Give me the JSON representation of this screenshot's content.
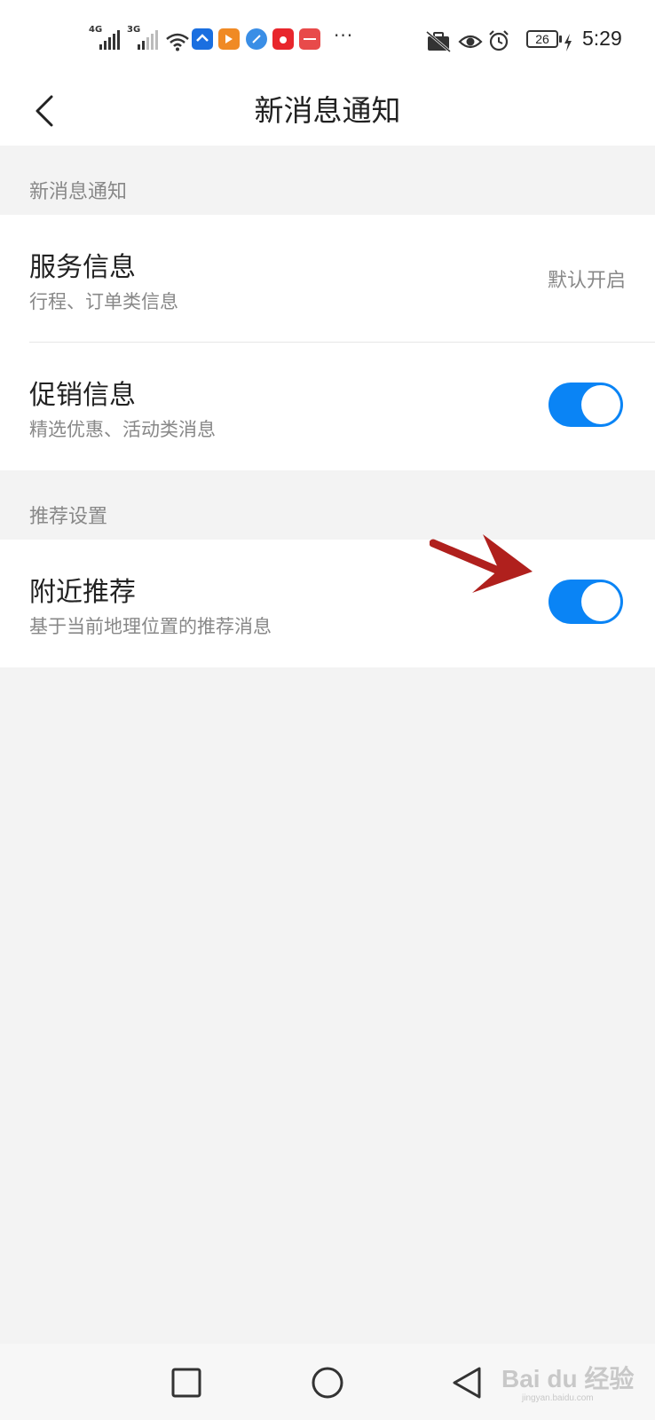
{
  "status_bar": {
    "sim1_label": "4G",
    "sim2_label": "3G",
    "battery": "26",
    "time": "5:29",
    "more": "···",
    "icons": [
      "signal-4g-icon",
      "signal-3g-icon",
      "wifi-icon",
      "app-icon-blue",
      "app-icon-orange",
      "app-icon-browser",
      "app-icon-taobao",
      "app-icon-huawei",
      "dnd-icon",
      "eye-icon",
      "alarm-icon",
      "battery-icon",
      "charging-icon"
    ]
  },
  "header": {
    "title": "新消息通知"
  },
  "sections": [
    {
      "label": "新消息通知",
      "rows": [
        {
          "title": "服务信息",
          "subtitle": "行程、订单类信息",
          "value": "默认开启"
        },
        {
          "title": "促销信息",
          "subtitle": "精选优惠、活动类消息",
          "toggle_on": true
        }
      ]
    },
    {
      "label": "推荐设置",
      "rows": [
        {
          "title": "附近推荐",
          "subtitle": "基于当前地理位置的推荐消息",
          "toggle_on": true
        }
      ]
    }
  ],
  "colors": {
    "toggle_on": "#0a84f5",
    "annotation_arrow": "#b0201d",
    "background": "#f3f3f3"
  },
  "watermark": {
    "text": "Bai du 经验",
    "sub": "jingyan.baidu.com"
  },
  "nav": [
    "recent-apps-button",
    "home-button",
    "back-nav-button"
  ]
}
